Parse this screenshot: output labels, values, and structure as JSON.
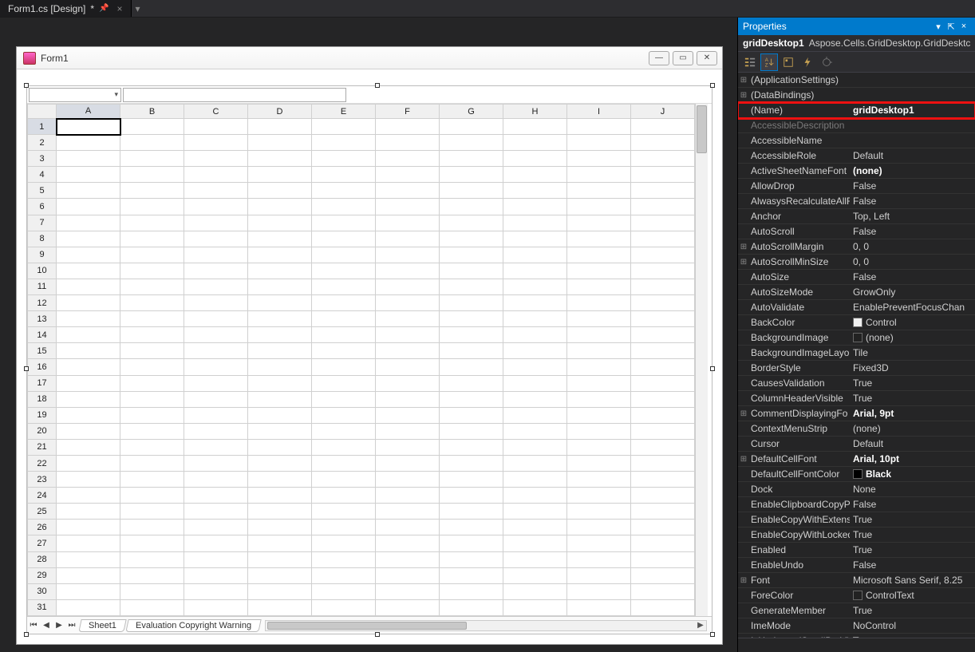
{
  "tab": {
    "title": "Form1.cs [Design]",
    "dirty": "*"
  },
  "form": {
    "title": "Form1"
  },
  "grid": {
    "columns": [
      "A",
      "B",
      "C",
      "D",
      "E",
      "F",
      "G",
      "H",
      "I",
      "J"
    ],
    "rows": 31,
    "sheet1_label": "Sheet1",
    "eval_label": "Evaluation Copyright Warning"
  },
  "props": {
    "panel_title": "Properties",
    "object_name": "gridDesktop1",
    "object_type": "Aspose.Cells.GridDesktop.GridDesktc",
    "desc_label": "",
    "rows": [
      {
        "exp": "+",
        "name": "(ApplicationSettings)",
        "val": "",
        "group": true
      },
      {
        "exp": "+",
        "name": "(DataBindings)",
        "val": "",
        "group": true,
        "muted": true
      },
      {
        "exp": "",
        "name": "(Name)",
        "val": "gridDesktop1",
        "bold": true,
        "hl": true
      },
      {
        "exp": "",
        "name": "AccessibleDescription",
        "val": "",
        "muted": true
      },
      {
        "exp": "",
        "name": "AccessibleName",
        "val": ""
      },
      {
        "exp": "",
        "name": "AccessibleRole",
        "val": "Default"
      },
      {
        "exp": "",
        "name": "ActiveSheetNameFont",
        "val": "(none)",
        "bold": true
      },
      {
        "exp": "",
        "name": "AllowDrop",
        "val": "False"
      },
      {
        "exp": "",
        "name": "AlwasysRecalculateAllF",
        "val": "False"
      },
      {
        "exp": "",
        "name": "Anchor",
        "val": "Top, Left"
      },
      {
        "exp": "",
        "name": "AutoScroll",
        "val": "False"
      },
      {
        "exp": "+",
        "name": "AutoScrollMargin",
        "val": "0, 0"
      },
      {
        "exp": "+",
        "name": "AutoScrollMinSize",
        "val": "0, 0"
      },
      {
        "exp": "",
        "name": "AutoSize",
        "val": "False"
      },
      {
        "exp": "",
        "name": "AutoSizeMode",
        "val": "GrowOnly"
      },
      {
        "exp": "",
        "name": "AutoValidate",
        "val": "EnablePreventFocusChan"
      },
      {
        "exp": "",
        "name": "BackColor",
        "val": "Control",
        "swatch": "#f0f0f0"
      },
      {
        "exp": "",
        "name": "BackgroundImage",
        "val": "(none)",
        "swatch": "#222"
      },
      {
        "exp": "",
        "name": "BackgroundImageLayo",
        "val": "Tile"
      },
      {
        "exp": "",
        "name": "BorderStyle",
        "val": "Fixed3D"
      },
      {
        "exp": "",
        "name": "CausesValidation",
        "val": "True"
      },
      {
        "exp": "",
        "name": "ColumnHeaderVisible",
        "val": "True"
      },
      {
        "exp": "+",
        "name": "CommentDisplayingFo",
        "val": "Arial, 9pt",
        "bold": true
      },
      {
        "exp": "",
        "name": "ContextMenuStrip",
        "val": "(none)"
      },
      {
        "exp": "",
        "name": "Cursor",
        "val": "Default"
      },
      {
        "exp": "+",
        "name": "DefaultCellFont",
        "val": "Arial, 10pt",
        "bold": true
      },
      {
        "exp": "",
        "name": "DefaultCellFontColor",
        "val": "Black",
        "bold": true,
        "swatch": "#000"
      },
      {
        "exp": "",
        "name": "Dock",
        "val": "None"
      },
      {
        "exp": "",
        "name": "EnableClipboardCopyP",
        "val": "False"
      },
      {
        "exp": "",
        "name": "EnableCopyWithExtensi",
        "val": "True"
      },
      {
        "exp": "",
        "name": "EnableCopyWithLocked",
        "val": "True"
      },
      {
        "exp": "",
        "name": "Enabled",
        "val": "True"
      },
      {
        "exp": "",
        "name": "EnableUndo",
        "val": "False"
      },
      {
        "exp": "+",
        "name": "Font",
        "val": "Microsoft Sans Serif, 8.25"
      },
      {
        "exp": "",
        "name": "ForeColor",
        "val": "ControlText",
        "swatch": "#222"
      },
      {
        "exp": "",
        "name": "GenerateMember",
        "val": "True"
      },
      {
        "exp": "",
        "name": "ImeMode",
        "val": "NoControl"
      },
      {
        "exp": "",
        "name": "IsHorizontalScrollBarVis",
        "val": "True",
        "bold": true
      }
    ]
  }
}
